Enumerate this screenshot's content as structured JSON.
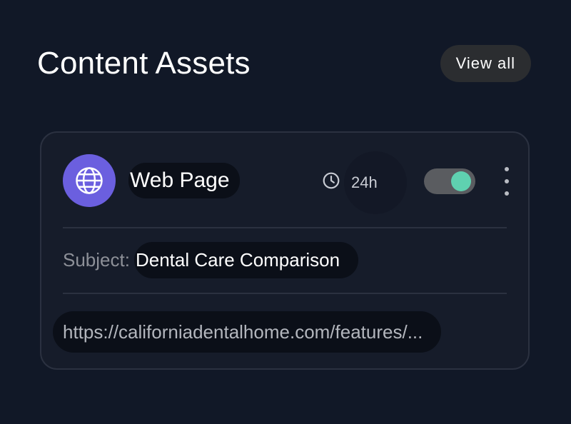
{
  "header": {
    "title": "Content Assets",
    "view_all_label": "View all"
  },
  "asset": {
    "type_label": "Web Page",
    "type_icon": "globe-icon",
    "frequency": "24h",
    "enabled": true,
    "subject_label": "Subject:",
    "subject_value": "Dental Care Comparison",
    "url": "https://californiadentalhome.com/features/..."
  },
  "colors": {
    "background": "#111827",
    "card": "#161c2a",
    "globe_badge": "#6b5fdf",
    "toggle_on": "#5fd1b0"
  }
}
